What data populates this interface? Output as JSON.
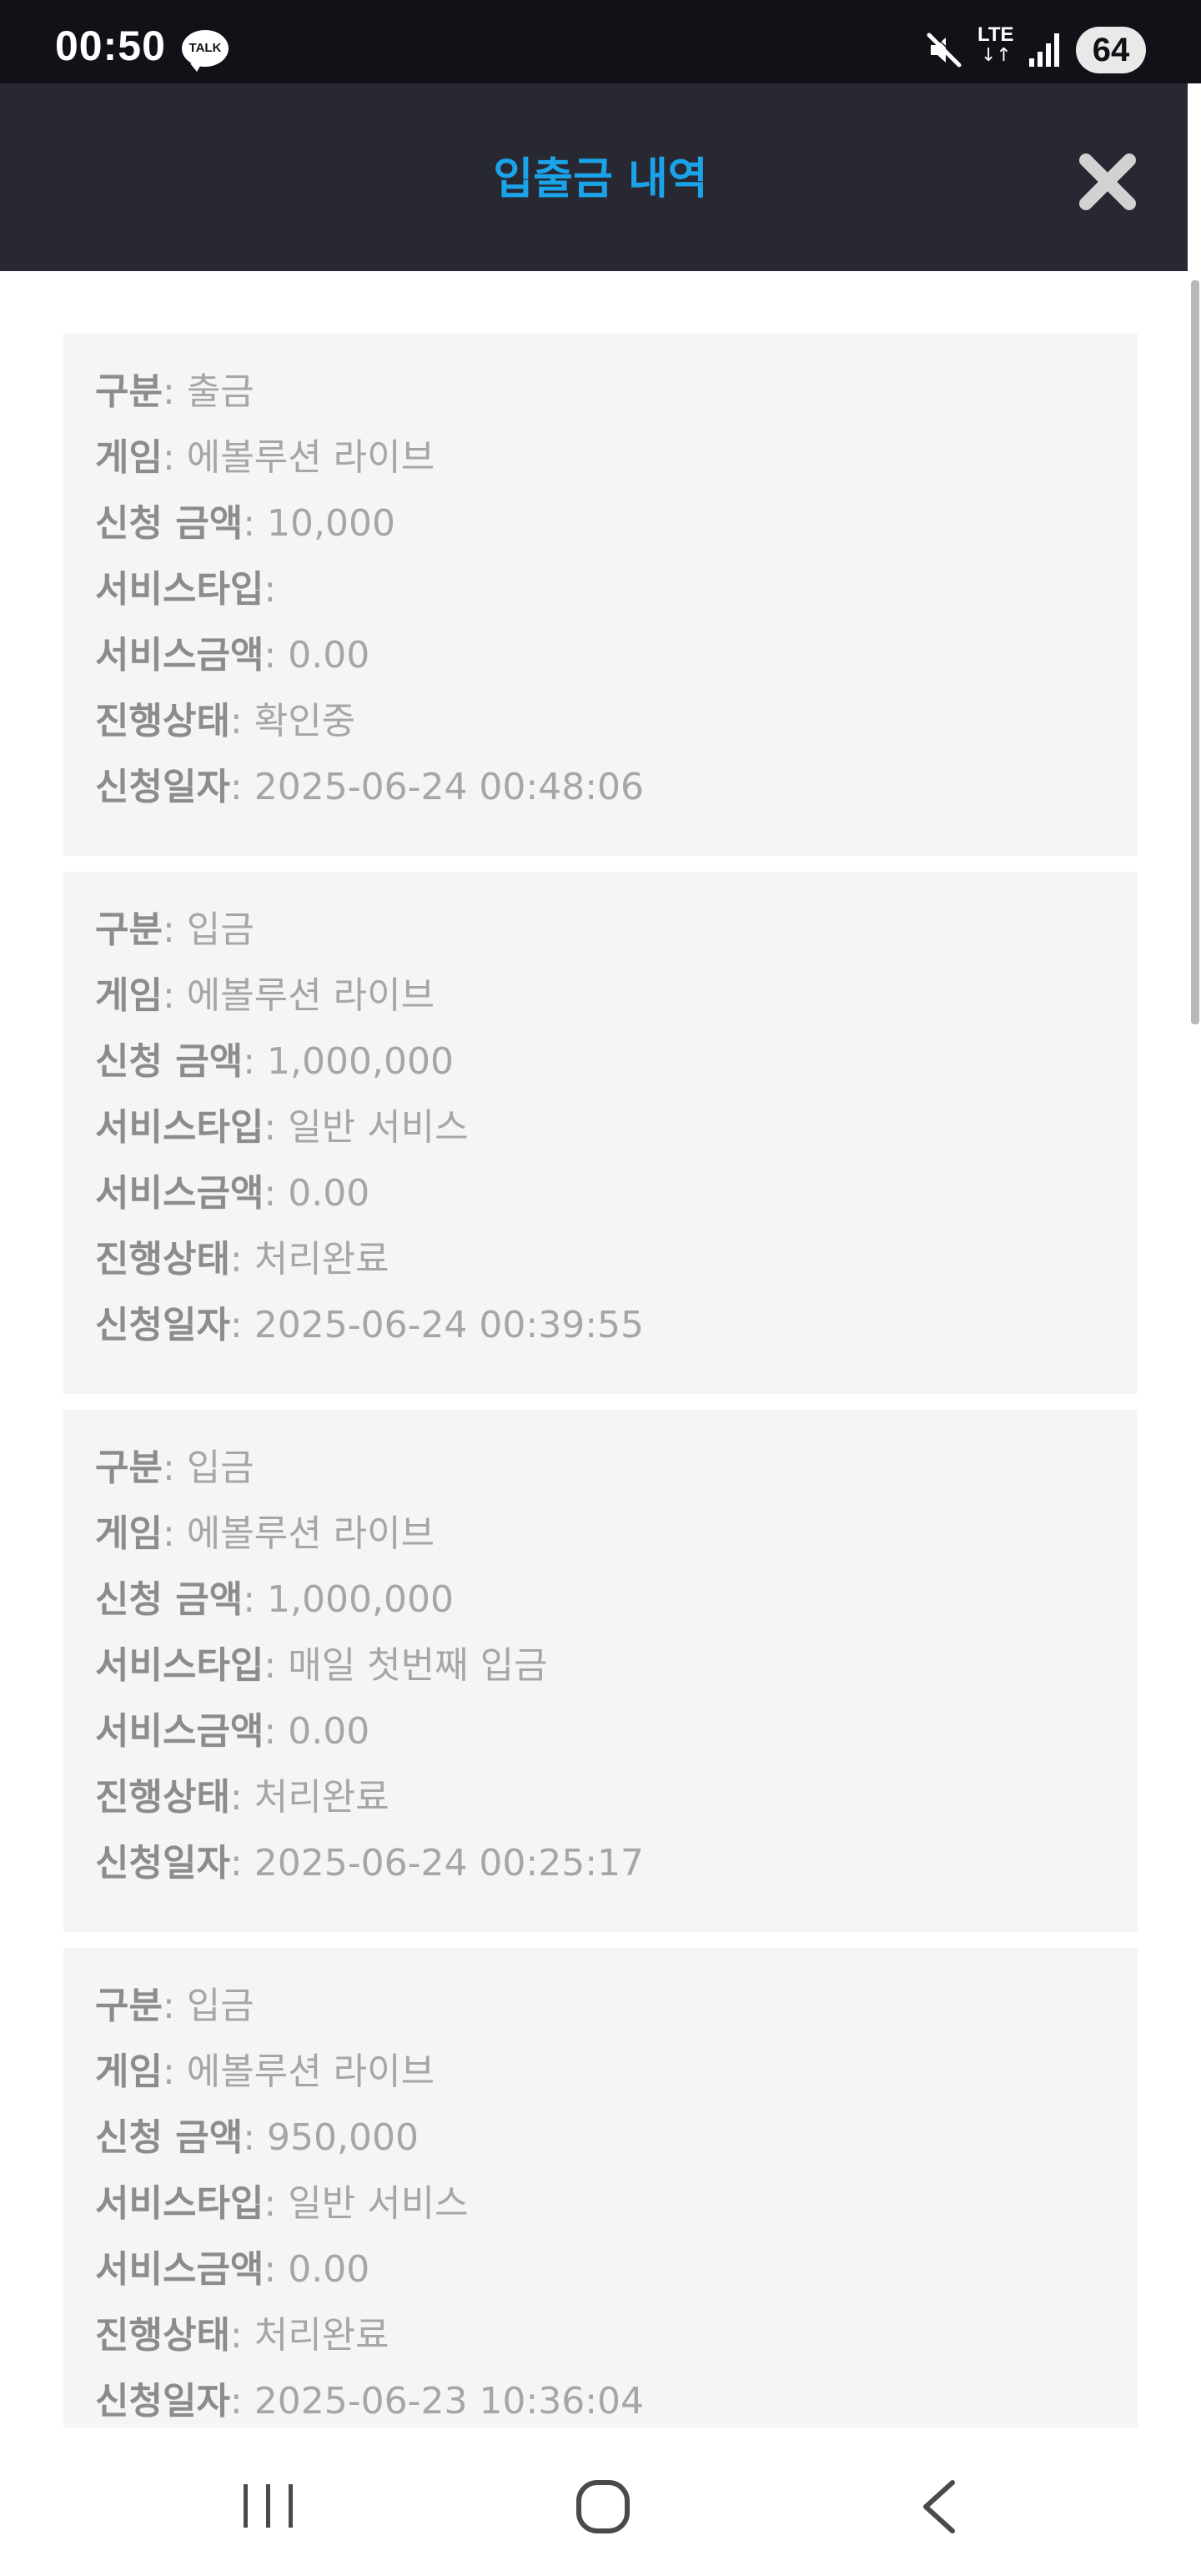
{
  "status_bar": {
    "time": "00:50",
    "talk_badge": "TALK",
    "network": "LTE",
    "network_arrows": "↓↑",
    "battery": "64",
    "icons": [
      "talk-icon",
      "mute-icon",
      "lte-icon",
      "signal-icon",
      "battery-icon"
    ]
  },
  "header": {
    "title": "입출금 내역",
    "close_icon": "close-icon"
  },
  "colors": {
    "title_accent": "#1aa3e8",
    "header_bg": "#282832",
    "card_bg": "#f5f5f5",
    "label_text": "#8c8c8c",
    "value_text": "#a6a6a6"
  },
  "records": [
    {
      "type": {
        "label": "구분",
        "value": ": 출금"
      },
      "game": {
        "label": "게임",
        "value": ": 에볼루션 라이브"
      },
      "amount": {
        "label": "신청 금액",
        "value": ": 10,000"
      },
      "service_type": {
        "label": "서비스타입",
        "value": ":"
      },
      "service_amount": {
        "label": "서비스금액",
        "value": ": 0.00"
      },
      "status": {
        "label": "진행상태",
        "value": ": 확인중"
      },
      "date": {
        "label": "신청일자",
        "value": ": 2025-06-24 00:48:06"
      }
    },
    {
      "type": {
        "label": "구분",
        "value": ": 입금"
      },
      "game": {
        "label": "게임",
        "value": ": 에볼루션 라이브"
      },
      "amount": {
        "label": "신청 금액",
        "value": ": 1,000,000"
      },
      "service_type": {
        "label": "서비스타입",
        "value": ": 일반 서비스"
      },
      "service_amount": {
        "label": "서비스금액",
        "value": ": 0.00"
      },
      "status": {
        "label": "진행상태",
        "value": ": 처리완료"
      },
      "date": {
        "label": "신청일자",
        "value": ": 2025-06-24 00:39:55"
      }
    },
    {
      "type": {
        "label": "구분",
        "value": ": 입금"
      },
      "game": {
        "label": "게임",
        "value": ": 에볼루션 라이브"
      },
      "amount": {
        "label": "신청 금액",
        "value": ": 1,000,000"
      },
      "service_type": {
        "label": "서비스타입",
        "value": ": 매일 첫번째 입금"
      },
      "service_amount": {
        "label": "서비스금액",
        "value": ": 0.00"
      },
      "status": {
        "label": "진행상태",
        "value": ": 처리완료"
      },
      "date": {
        "label": "신청일자",
        "value": ": 2025-06-24 00:25:17"
      }
    },
    {
      "type": {
        "label": "구분",
        "value": ": 입금"
      },
      "game": {
        "label": "게임",
        "value": ": 에볼루션 라이브"
      },
      "amount": {
        "label": "신청 금액",
        "value": ": 950,000"
      },
      "service_type": {
        "label": "서비스타입",
        "value": ": 일반 서비스"
      },
      "service_amount": {
        "label": "서비스금액",
        "value": ": 0.00"
      },
      "status": {
        "label": "진행상태",
        "value": ": 처리완료"
      },
      "date": {
        "label": "신청일자",
        "value": ": 2025-06-23 10:36:04"
      }
    }
  ],
  "nav_bar": {
    "icons": [
      "recent-apps-icon",
      "home-icon",
      "back-icon"
    ]
  }
}
